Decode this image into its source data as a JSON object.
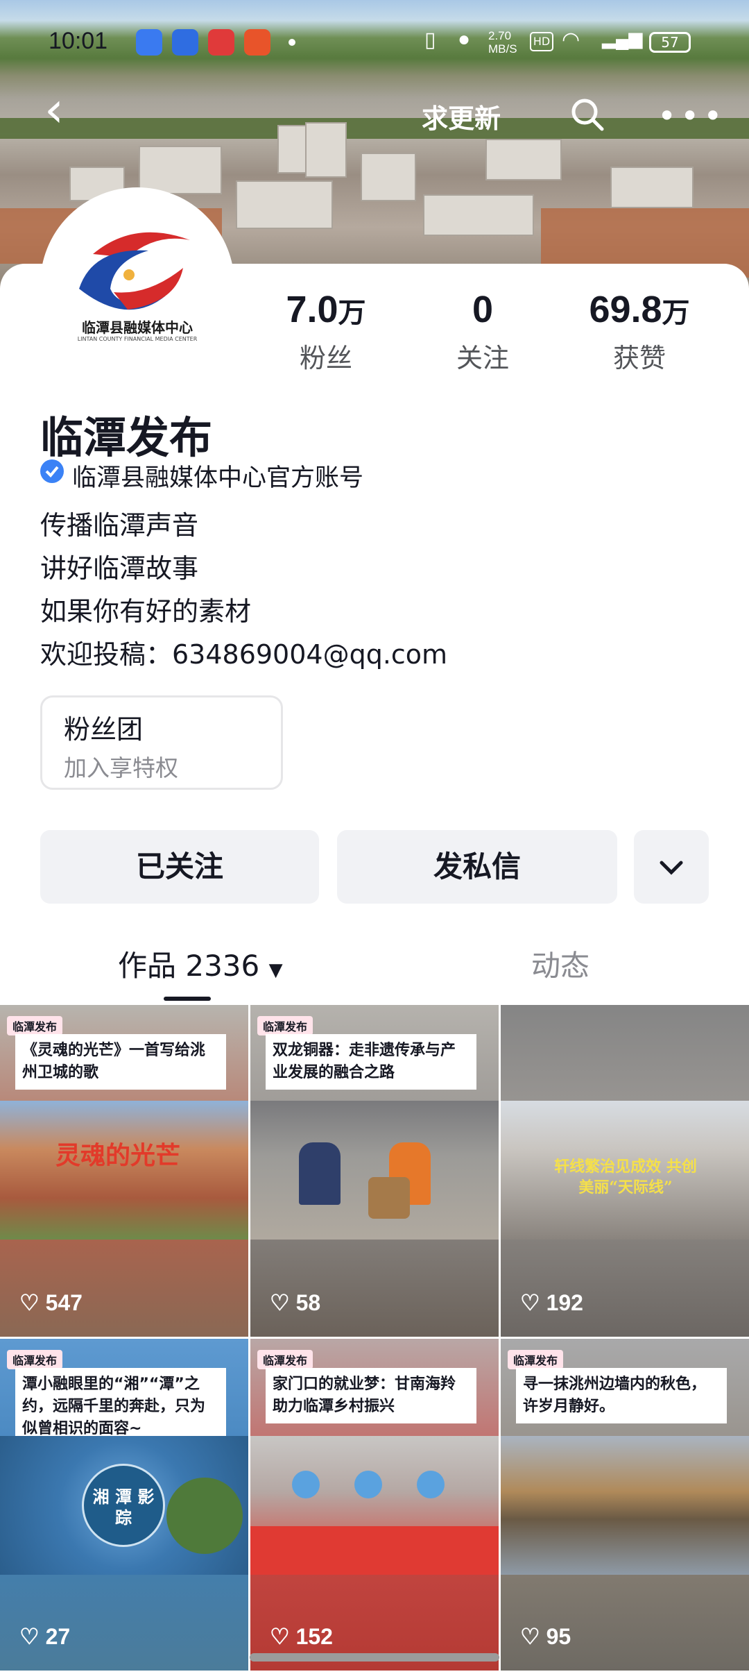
{
  "status_bar": {
    "time": "10:01",
    "net_speed": "2.70 MB/S",
    "battery": "57"
  },
  "nav": {
    "title": "求更新"
  },
  "profile": {
    "avatar_text": "临潭县融媒体中心",
    "avatar_subtext": "LINTAN COUNTY FINANCIAL MEDIA CENTER",
    "name": "临潭发布",
    "verified_text": "临潭县融媒体中心官方账号",
    "bio": [
      "传播临潭声音",
      "讲好临潭故事",
      "如果你有好的素材",
      "欢迎投稿：634869004@qq.com"
    ]
  },
  "stats": [
    {
      "value": "7.0",
      "unit": "万",
      "label": "粉丝"
    },
    {
      "value": "0",
      "unit": "",
      "label": "关注"
    },
    {
      "value": "69.8",
      "unit": "万",
      "label": "获赞"
    }
  ],
  "fan_club": {
    "title": "粉丝团",
    "subtitle": "加入享特权"
  },
  "actions": {
    "follow_label": "已关注",
    "message_label": "发私信"
  },
  "tabs": {
    "works_label": "作品 2336",
    "dynamic_label": "动态"
  },
  "videos": [
    {
      "tag": "临潭发布",
      "caption": "《灵魂的光芒》一首写给洮州卫城的歌",
      "overlay": "灵魂的光芒",
      "likes": "547"
    },
    {
      "tag": "临潭发布",
      "caption": "双龙铜器：走非遗传承与产业发展的融合之路",
      "overlay": "",
      "likes": "58"
    },
    {
      "tag": "",
      "caption": "",
      "overlay": "轩线繁治见成效 共创美丽“天际线”",
      "likes": "192"
    },
    {
      "tag": "临潭发布",
      "caption": "潭小融眼里的“湘”“潭”之约，远隔千里的奔赴，只为似曾相识的面容~",
      "overlay": "湘 潭 影 踪",
      "likes": "27"
    },
    {
      "tag": "临潭发布",
      "caption": "家门口的就业梦：甘南海羚助力临潭乡村振兴",
      "overlay": "",
      "likes": "152"
    },
    {
      "tag": "临潭发布",
      "caption": "寻一抹洮州边墙内的秋色，许岁月静好。",
      "overlay": "",
      "likes": "95"
    }
  ],
  "colors": {
    "verified": "#3b82f6",
    "button_bg": "#f1f2f5",
    "text_primary": "#161823",
    "text_secondary": "#535559"
  }
}
